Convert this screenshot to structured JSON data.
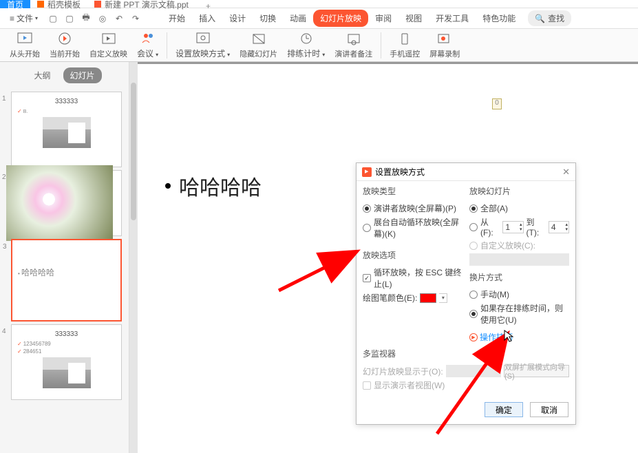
{
  "tabs": {
    "home": "首页",
    "template": "稻壳模板",
    "doc": "新建 PPT 演示文稿.ppt",
    "add": "+"
  },
  "menu": {
    "hamburger": "≡",
    "file": "文件",
    "start": "开始",
    "insert": "插入",
    "design": "设计",
    "transition": "切换",
    "animation": "动画",
    "slideshow": "幻灯片放映",
    "review": "审阅",
    "view": "视图",
    "devtools": "开发工具",
    "special": "特色功能",
    "search": "查找"
  },
  "toolbar": {
    "fromStart": "从头开始",
    "fromCurrent": "当前开始",
    "custom": "自定义放映",
    "meeting": "会议",
    "setup": "设置放映方式",
    "hide": "隐藏幻灯片",
    "rehearse": "排练计时",
    "presenter": "演讲者备注",
    "mobile": "手机遥控",
    "record": "屏幕录制"
  },
  "sidebar": {
    "outline": "大纲",
    "slides": "幻灯片",
    "slide1": {
      "num": "1",
      "title": "333333",
      "sub": "B."
    },
    "slide2": {
      "num": "2"
    },
    "slide3": {
      "num": "3",
      "text": "哈哈哈哈"
    },
    "slide4": {
      "num": "4",
      "title": "333333",
      "sub1": "123456789",
      "sub2": "284651"
    }
  },
  "canvas": {
    "marker": "0",
    "text": "哈哈哈哈"
  },
  "dialog": {
    "title": "设置放映方式",
    "group1": "放映类型",
    "opt1a": "演讲者放映(全屏幕)(P)",
    "opt1b": "展台自动循环放映(全屏幕)(K)",
    "group2": "放映选项",
    "opt2a": "循环放映，按 ESC 键终止(L)",
    "pencolor": "绘图笔颜色(E):",
    "group3": "多监视器",
    "monitor": "幻灯片放映显示于(O):",
    "dualscreen": "双屏扩展模式向导(S)",
    "showPresenter": "显示演示者视图(W)",
    "group4": "放映幻灯片",
    "opt4a": "全部(A)",
    "opt4b_from": "从(F):",
    "opt4b_val1": "1",
    "opt4b_to": "到(T):",
    "opt4b_val2": "4",
    "opt4c": "自定义放映(C):",
    "group5": "换片方式",
    "opt5a": "手动(M)",
    "opt5b": "如果存在排练时间，则使用它(U)",
    "tips": "操作技巧",
    "ok": "确定",
    "cancel": "取消"
  }
}
